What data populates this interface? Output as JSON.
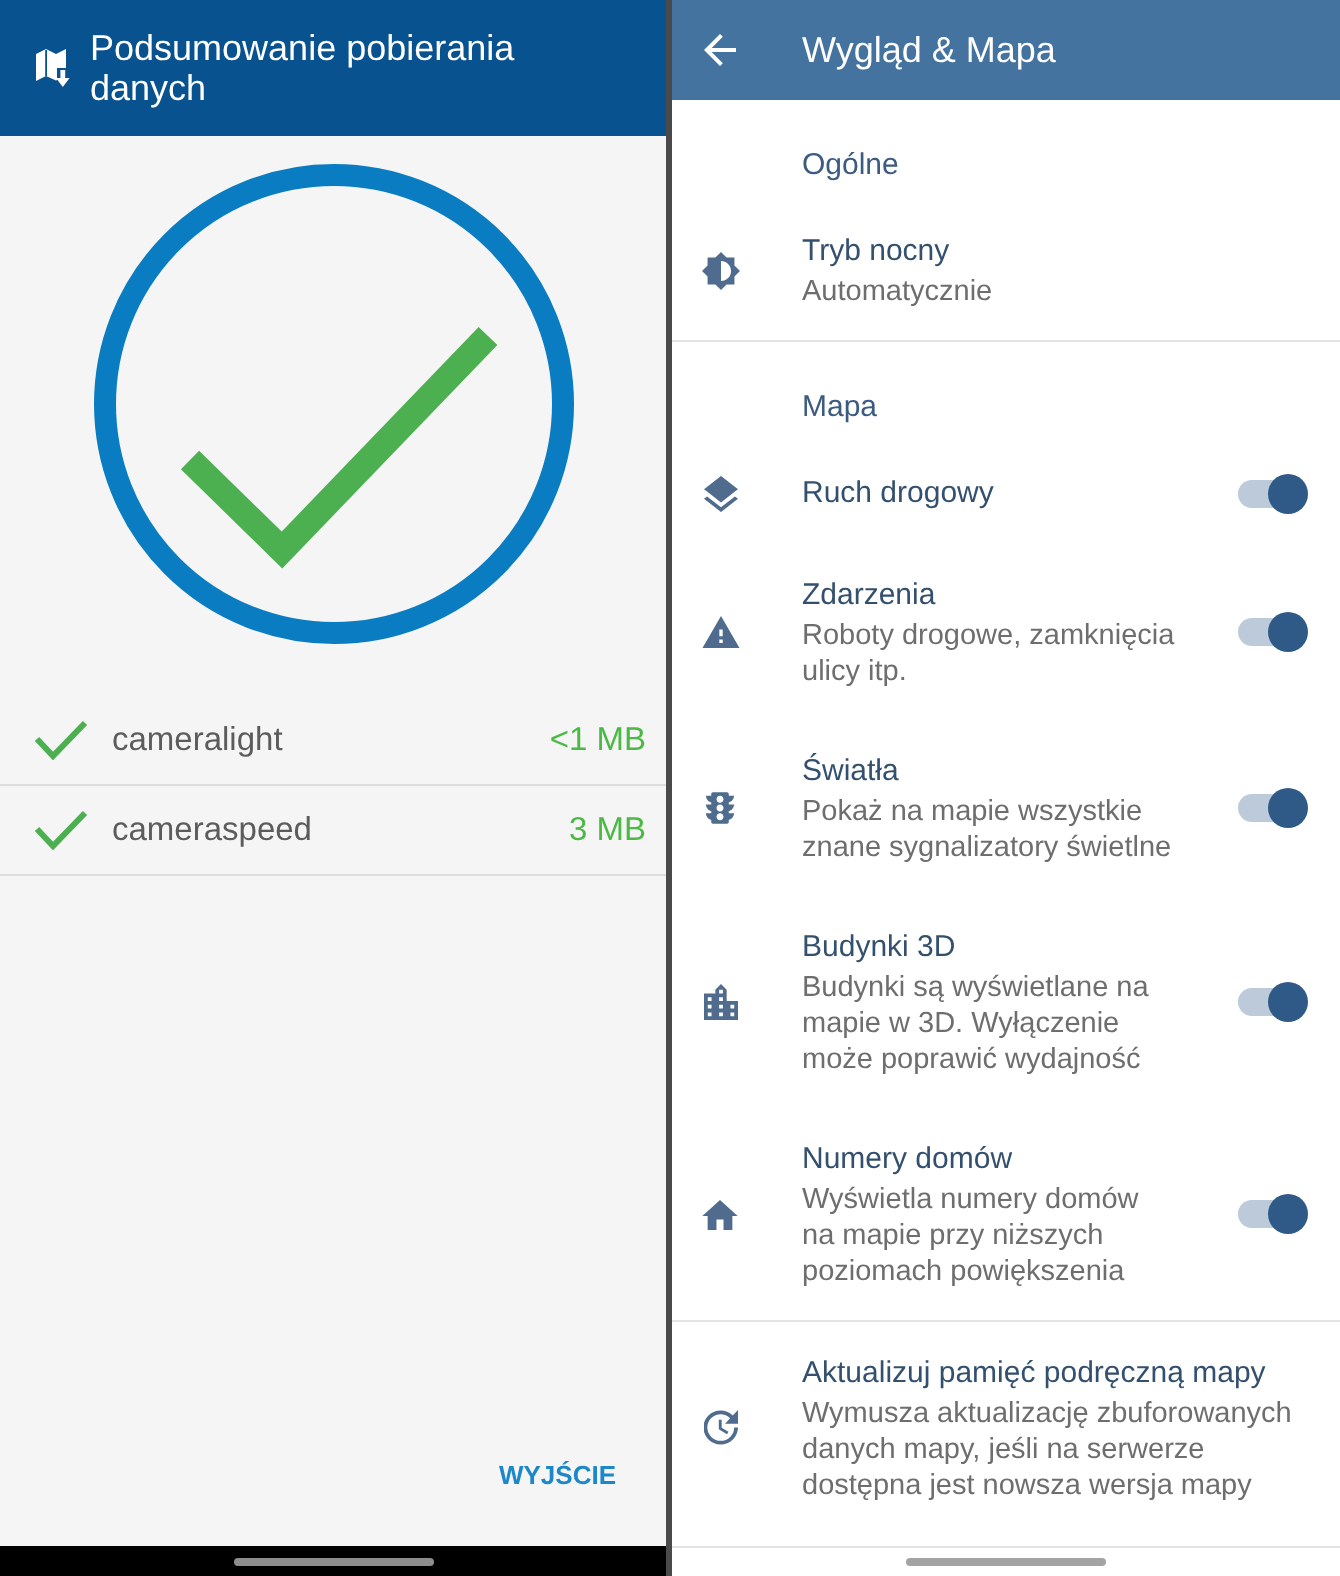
{
  "download_summary": {
    "header": {
      "title": "Podsumowanie pobierania danych"
    },
    "downloads": [
      {
        "name": "cameralight",
        "size": "<1 MB",
        "done": true
      },
      {
        "name": "cameraspeed",
        "size": "3 MB",
        "done": true
      }
    ],
    "exit_button": {
      "label": "WYJŚCIE"
    }
  },
  "appearance_settings": {
    "header": {
      "title": "Wygląd & Mapa"
    },
    "sections": [
      {
        "title": "Ogólne",
        "items": [
          {
            "kind": "text",
            "title": "Tryb nocny",
            "description": "Automatycznie"
          }
        ]
      },
      {
        "title": "Mapa",
        "items": [
          {
            "kind": "toggle",
            "title": "Ruch drogowy",
            "on": true
          },
          {
            "kind": "toggle",
            "title": "Zdarzenia",
            "description": "Roboty drogowe, zamknięcia\nulicy itp.",
            "on": true
          },
          {
            "kind": "toggle",
            "title": "Światła",
            "description": "Pokaż na mapie wszystkie\nznane sygnalizatory świetlne",
            "on": true
          },
          {
            "kind": "toggle",
            "title": "Budynki 3D",
            "description": "Budynki są wyświetlane na\nmapie w 3D. Wyłączenie\nmoże poprawić wydajność",
            "on": true
          },
          {
            "kind": "toggle",
            "title": "Numery domów",
            "description": "Wyświetla numery domów\nna mapie przy niższych\npoziomach powiększenia",
            "on": true
          }
        ]
      },
      {
        "items": [
          {
            "kind": "text",
            "title": "Aktualizuj pamięć podręczną mapy",
            "description": "Wymusza aktualizację zbuforowanych\ndanych mapy, jeśli na serwerze\ndostępna jest nowsza wersja mapy"
          }
        ]
      }
    ]
  }
}
